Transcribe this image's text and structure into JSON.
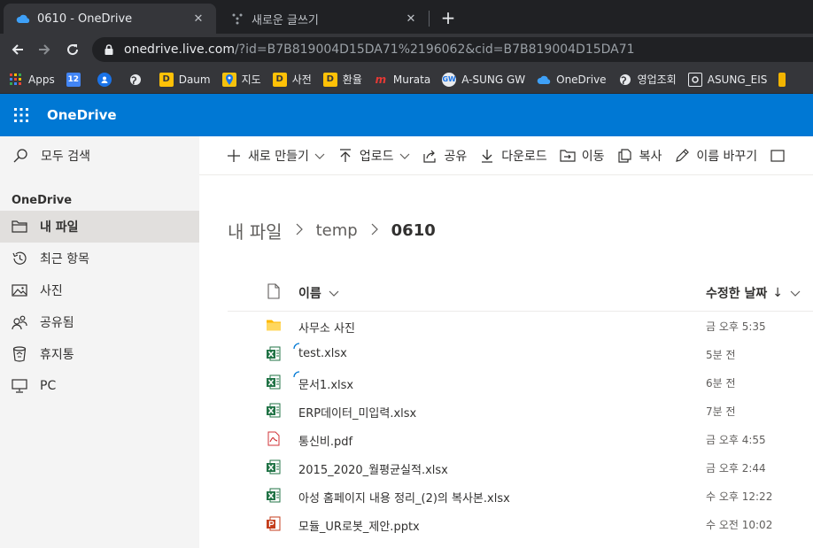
{
  "browser": {
    "tabs": [
      {
        "title": "0610 - OneDrive",
        "icon": "onedrive-cloud-icon",
        "active": true
      },
      {
        "title": "새로운 글쓰기",
        "icon": "dots-icon",
        "active": false
      }
    ],
    "url_host": "onedrive.live.com",
    "url_path": "/?id=B7B819004D15DA71%2196062&cid=B7B819004D15DA71",
    "bookmarks": [
      {
        "label": "Apps",
        "icon": "apps-grid-icon"
      },
      {
        "label": "",
        "icon": "calendar-12-icon"
      },
      {
        "label": "",
        "icon": "profile-icon"
      },
      {
        "label": "",
        "icon": "globe-icon"
      },
      {
        "label": "Daum",
        "icon": "daum-d-icon"
      },
      {
        "label": "지도",
        "icon": "map-pin-icon"
      },
      {
        "label": "사전",
        "icon": "daum-d-icon"
      },
      {
        "label": "환율",
        "icon": "daum-d-icon"
      },
      {
        "label": "Murata",
        "icon": "murata-logo-icon"
      },
      {
        "label": "A-SUNG GW",
        "icon": "gw-icon"
      },
      {
        "label": "OneDrive",
        "icon": "onedrive-cloud-icon"
      },
      {
        "label": "영업조회",
        "icon": "globe-icon"
      },
      {
        "label": "ASUNG_EIS",
        "icon": "eis-icon"
      }
    ]
  },
  "app": {
    "title": "OneDrive"
  },
  "sidebar": {
    "search_label": "모두 검색",
    "section_title": "OneDrive",
    "items": [
      {
        "label": "내 파일",
        "icon": "folder-icon",
        "selected": true
      },
      {
        "label": "최근 항목",
        "icon": "recent-clock-icon",
        "selected": false
      },
      {
        "label": "사진",
        "icon": "photo-icon",
        "selected": false
      },
      {
        "label": "공유됨",
        "icon": "shared-people-icon",
        "selected": false
      },
      {
        "label": "휴지통",
        "icon": "recycle-bin-icon",
        "selected": false
      },
      {
        "label": "PC",
        "icon": "pc-icon",
        "selected": false
      }
    ]
  },
  "commands": [
    {
      "label": "새로 만들기",
      "icon": "plus-icon",
      "dropdown": true
    },
    {
      "label": "업로드",
      "icon": "upload-arrow-icon",
      "dropdown": true
    },
    {
      "label": "공유",
      "icon": "share-icon",
      "dropdown": false
    },
    {
      "label": "다운로드",
      "icon": "download-arrow-icon",
      "dropdown": false
    },
    {
      "label": "이동",
      "icon": "move-icon",
      "dropdown": false
    },
    {
      "label": "복사",
      "icon": "copy-icon",
      "dropdown": false
    },
    {
      "label": "이름 바꾸기",
      "icon": "pencil-icon",
      "dropdown": false
    }
  ],
  "breadcrumb": {
    "items": [
      "내 파일",
      "temp"
    ],
    "current": "0610"
  },
  "list": {
    "header_name": "이름",
    "header_modified": "수정한 날짜",
    "header_sort_arrow": "↓",
    "files": [
      {
        "name": "사무소 사진",
        "type": "folder",
        "modified": "금 오후 5:35",
        "syncing": false
      },
      {
        "name": "test.xlsx",
        "type": "excel",
        "modified": "5분 전",
        "syncing": true
      },
      {
        "name": "문서1.xlsx",
        "type": "excel",
        "modified": "6분 전",
        "syncing": true
      },
      {
        "name": "ERP데이터_미입력.xlsx",
        "type": "excel",
        "modified": "7분 전",
        "syncing": false
      },
      {
        "name": "통신비.pdf",
        "type": "pdf",
        "modified": "금 오후 4:55",
        "syncing": false
      },
      {
        "name": "2015_2020_월평균실적.xlsx",
        "type": "excel",
        "modified": "금 오후 2:44",
        "syncing": false
      },
      {
        "name": "아성 홈페이지 내용 정리_(2)의 복사본.xlsx",
        "type": "excel",
        "modified": "수 오후 12:22",
        "syncing": false
      },
      {
        "name": "모듈_UR로봇_제안.pptx",
        "type": "powerpoint",
        "modified": "수 오전 10:02",
        "syncing": false
      }
    ]
  },
  "colors": {
    "brand_blue": "#0078d4",
    "excel_green": "#217346",
    "pdf_red": "#d13438",
    "ppt_orange": "#c43e1c",
    "folder_yellow": "#ffb900"
  }
}
